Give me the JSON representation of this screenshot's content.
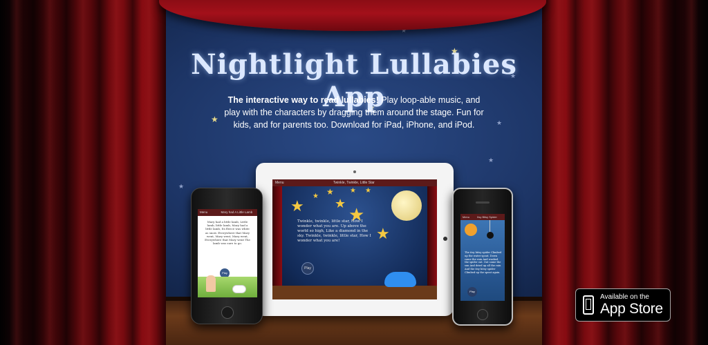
{
  "hero": {
    "title": "Nightlight Lullabies App",
    "description_bold": "The interactive way to read lullabies!",
    "description_rest": " Play loop-able music, and play with the characters by dragging them around the stage. Fun for kids, and for parents too. Download for iPad, iPhone, and iPod."
  },
  "ipad_screen": {
    "menu_label": "Menu",
    "song_title": "Twinkle, Twinkle, Little Star",
    "lyrics": "Twinkle, twinkle, little star, How I wonder what you are. Up above the world so high, Like a diamond in the sky. Twinkle, twinkle, little star, How I wonder what you are!",
    "play_label": "Play"
  },
  "ipod_screen": {
    "menu_label": "Menu",
    "song_title": "Mary had A Little Lamb",
    "lyrics": "Mary had a little lamb, Little lamb, little lamb, Mary had a little lamb, Its fleece was white as snow. Everywhere that Mary went, Mary went, Mary went, Everywhere that Mary went The lamb was sure to go.",
    "play_label": "Play"
  },
  "iphone_screen": {
    "menu_label": "Menu",
    "song_title": "Itsy Bitsy Spider",
    "lyrics": "The itsy bitsy spider Climbed up the water spout. Down came the rain And washed the spider out. Out came the sun And dried up all the rain And the itsy bitsy spider Climbed up the spout again.",
    "play_label": "Play"
  },
  "app_store_badge": {
    "line1": "Available on the",
    "line2": "App Store"
  },
  "colors": {
    "sky": "#1d3566",
    "curtain": "#8a0c12",
    "star": "#e8d98a"
  }
}
